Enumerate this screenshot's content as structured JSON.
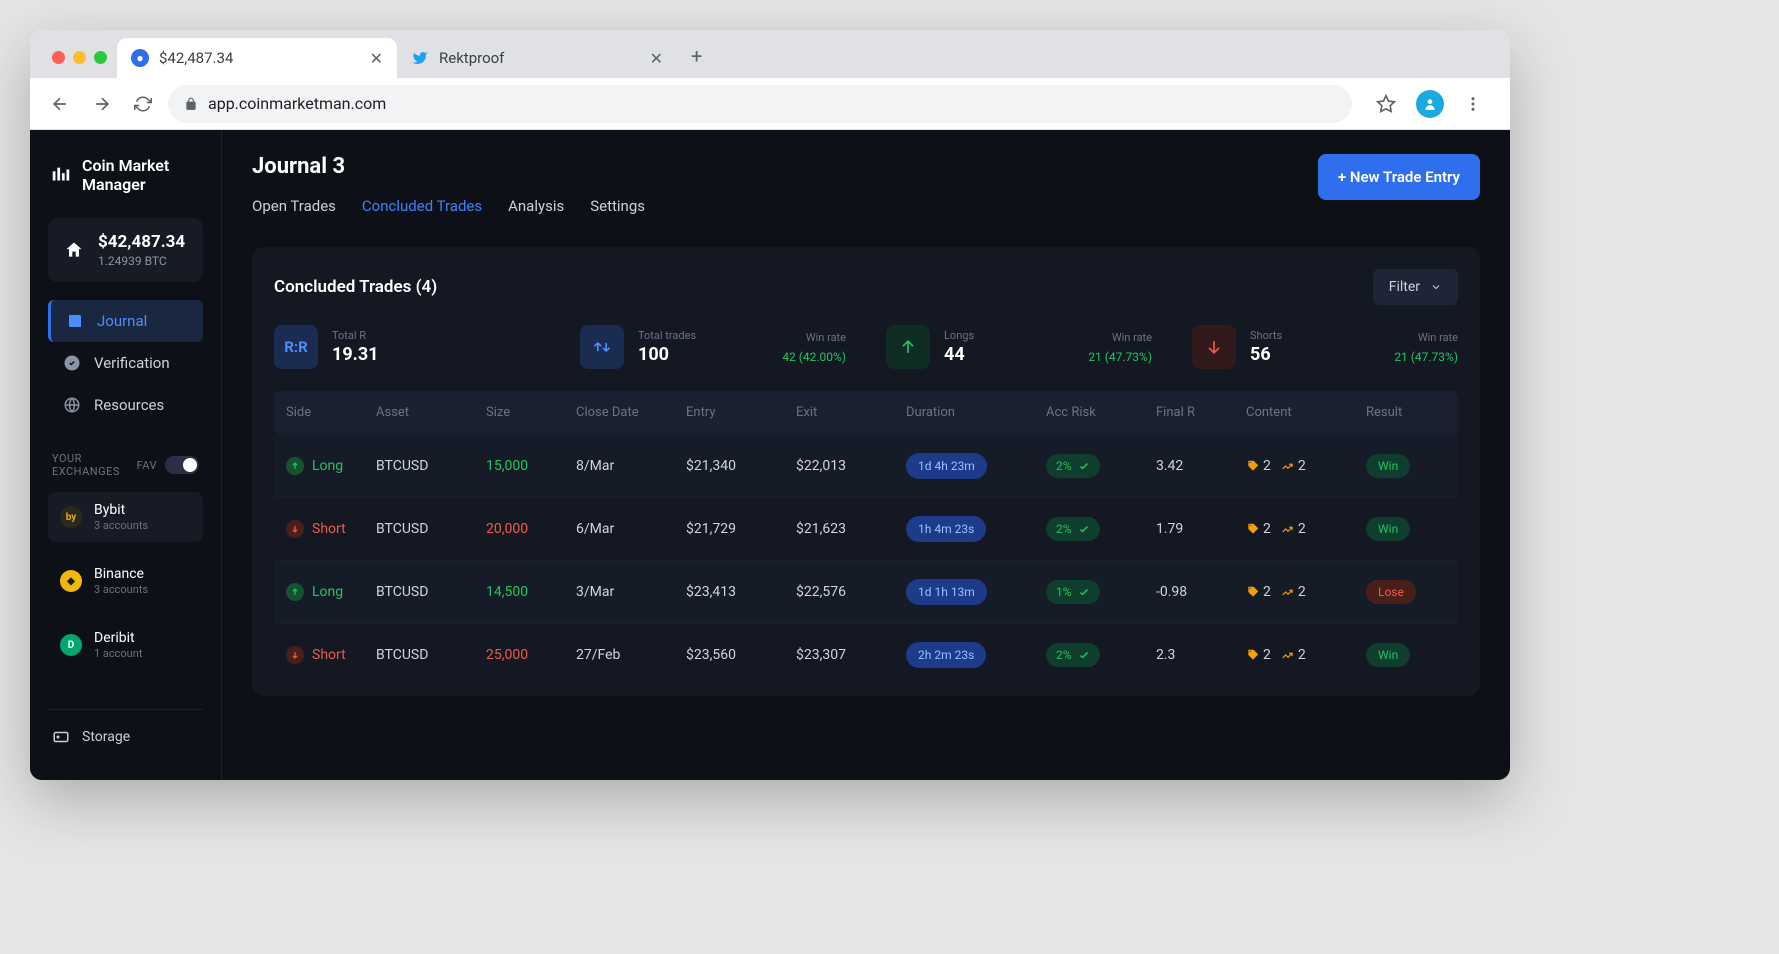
{
  "browser": {
    "tabs": [
      {
        "title": "$42,487.34",
        "favicon_bg": "#2f6fed",
        "active": true
      },
      {
        "title": "Rektproof",
        "favicon_bg": "#1da1f2",
        "active": false
      }
    ],
    "url_display": "app.coinmarketman.com"
  },
  "sidebar": {
    "brand_line1": "Coin Market",
    "brand_line2": "Manager",
    "balance_usd": "$42,487.34",
    "balance_btc": "1.24939 BTC",
    "nav": [
      {
        "label": "Journal",
        "active": true
      },
      {
        "label": "Verification",
        "active": false
      },
      {
        "label": "Resources",
        "active": false
      }
    ],
    "exchanges_label": "YOUR EXCHANGES",
    "fav_label": "FAV",
    "exchanges": [
      {
        "name": "Bybit",
        "sub": "3 accounts",
        "color": "#f7a600",
        "active": true
      },
      {
        "name": "Binance",
        "sub": "3 accounts",
        "color": "#f0b90b",
        "active": false
      },
      {
        "name": "Deribit",
        "sub": "1 account",
        "color": "#03a66d",
        "active": false
      }
    ],
    "storage_label": "Storage"
  },
  "header": {
    "title": "Journal 3",
    "tabs": [
      "Open Trades",
      "Concluded Trades",
      "Analysis",
      "Settings"
    ],
    "active_tab": "Concluded Trades",
    "new_entry_label": "+ New Trade Entry"
  },
  "panel": {
    "title": "Concluded Trades (4)",
    "filter_label": "Filter",
    "stats": {
      "totalR": {
        "label": "Total R",
        "value": "19.31"
      },
      "totalTrades": {
        "label": "Total trades",
        "value": "100",
        "wr_label": "Win rate",
        "wr_value": "42 (42.00%)"
      },
      "longs": {
        "label": "Longs",
        "value": "44",
        "wr_label": "Win rate",
        "wr_value": "21 (47.73%)"
      },
      "shorts": {
        "label": "Shorts",
        "value": "56",
        "wr_label": "Win rate",
        "wr_value": "21 (47.73%)"
      }
    },
    "columns": [
      "Side",
      "Asset",
      "Size",
      "Close Date",
      "Entry",
      "Exit",
      "Duration",
      "Acc Risk",
      "Final R",
      "Content",
      "Result"
    ],
    "rows": [
      {
        "side": "Long",
        "asset": "BTCUSD",
        "size": "15,000",
        "close": "8/Mar",
        "entry": "$21,340",
        "exit": "$22,013",
        "duration": "1d 4h 23m",
        "risk": "2%",
        "finalR": "3.42",
        "tags": "2",
        "charts": "2",
        "result": "Win"
      },
      {
        "side": "Short",
        "asset": "BTCUSD",
        "size": "20,000",
        "close": "6/Mar",
        "entry": "$21,729",
        "exit": "$21,623",
        "duration": "1h 4m 23s",
        "risk": "2%",
        "finalR": "1.79",
        "tags": "2",
        "charts": "2",
        "result": "Win"
      },
      {
        "side": "Long",
        "asset": "BTCUSD",
        "size": "14,500",
        "close": "3/Mar",
        "entry": "$23,413",
        "exit": "$22,576",
        "duration": "1d 1h 13m",
        "risk": "1%",
        "finalR": "-0.98",
        "tags": "2",
        "charts": "2",
        "result": "Lose"
      },
      {
        "side": "Short",
        "asset": "BTCUSD",
        "size": "25,000",
        "close": "27/Feb",
        "entry": "$23,560",
        "exit": "$23,307",
        "duration": "2h 2m 23s",
        "risk": "2%",
        "finalR": "2.3",
        "tags": "2",
        "charts": "2",
        "result": "Win"
      }
    ]
  }
}
